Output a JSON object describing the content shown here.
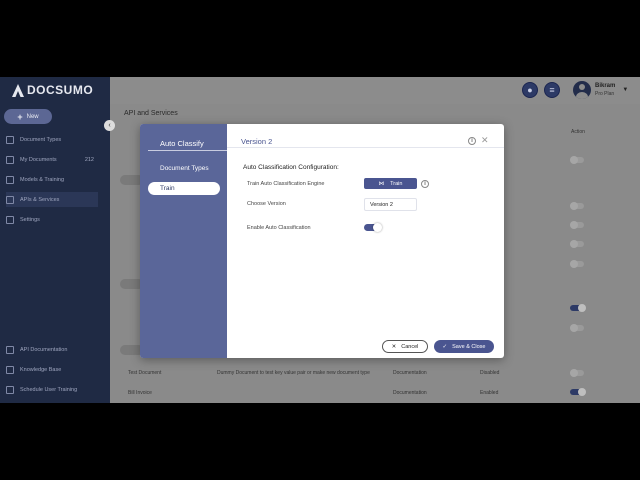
{
  "app": {
    "logo_text": "DOCSUMO",
    "user_name": "Bikram",
    "user_role": "Pro Plan"
  },
  "sidebar": {
    "new_button": "New",
    "items": [
      {
        "label": "Document Types",
        "icon": "document-icon"
      },
      {
        "label": "My Documents",
        "icon": "folder-icon",
        "count": "212"
      },
      {
        "label": "Models & Training",
        "icon": "model-icon"
      },
      {
        "label": "APIs & Services",
        "icon": "api-icon",
        "active": true
      },
      {
        "label": "Settings",
        "icon": "wrench-icon"
      }
    ],
    "bottom_items": [
      {
        "label": "API Documentation",
        "icon": "book-icon"
      },
      {
        "label": "Knowledge Base",
        "icon": "knowledge-icon"
      },
      {
        "label": "Schedule User Training",
        "icon": "calendar-icon"
      }
    ]
  },
  "background": {
    "page_title": "API and Services",
    "action_header": "Action",
    "rows": [
      {
        "name": "Test Document",
        "description": "Dummy Document to test key value pair or make new document type",
        "link": "Documentation",
        "status": "Disabled"
      },
      {
        "name": "Bill Invoice",
        "link": "Documentation",
        "status": "Enabled"
      }
    ]
  },
  "modal": {
    "side_title": "Auto Classify",
    "steps": [
      "Document Types",
      "Train"
    ],
    "title": "Version 2",
    "section_title": "Auto Classification Configuration:",
    "fields": {
      "train_label": "Train Auto Classification Engine",
      "train_button": "Train",
      "version_label": "Choose Version",
      "version_value": "Version 2",
      "enable_label": "Enable Auto Classification",
      "enabled": true
    },
    "cancel_label": "Cancel",
    "save_label": "Save & Close"
  },
  "colors": {
    "brand_dark": "#1f2a44",
    "accent": "#4a5590",
    "modal_sidebar": "#5a6699"
  }
}
